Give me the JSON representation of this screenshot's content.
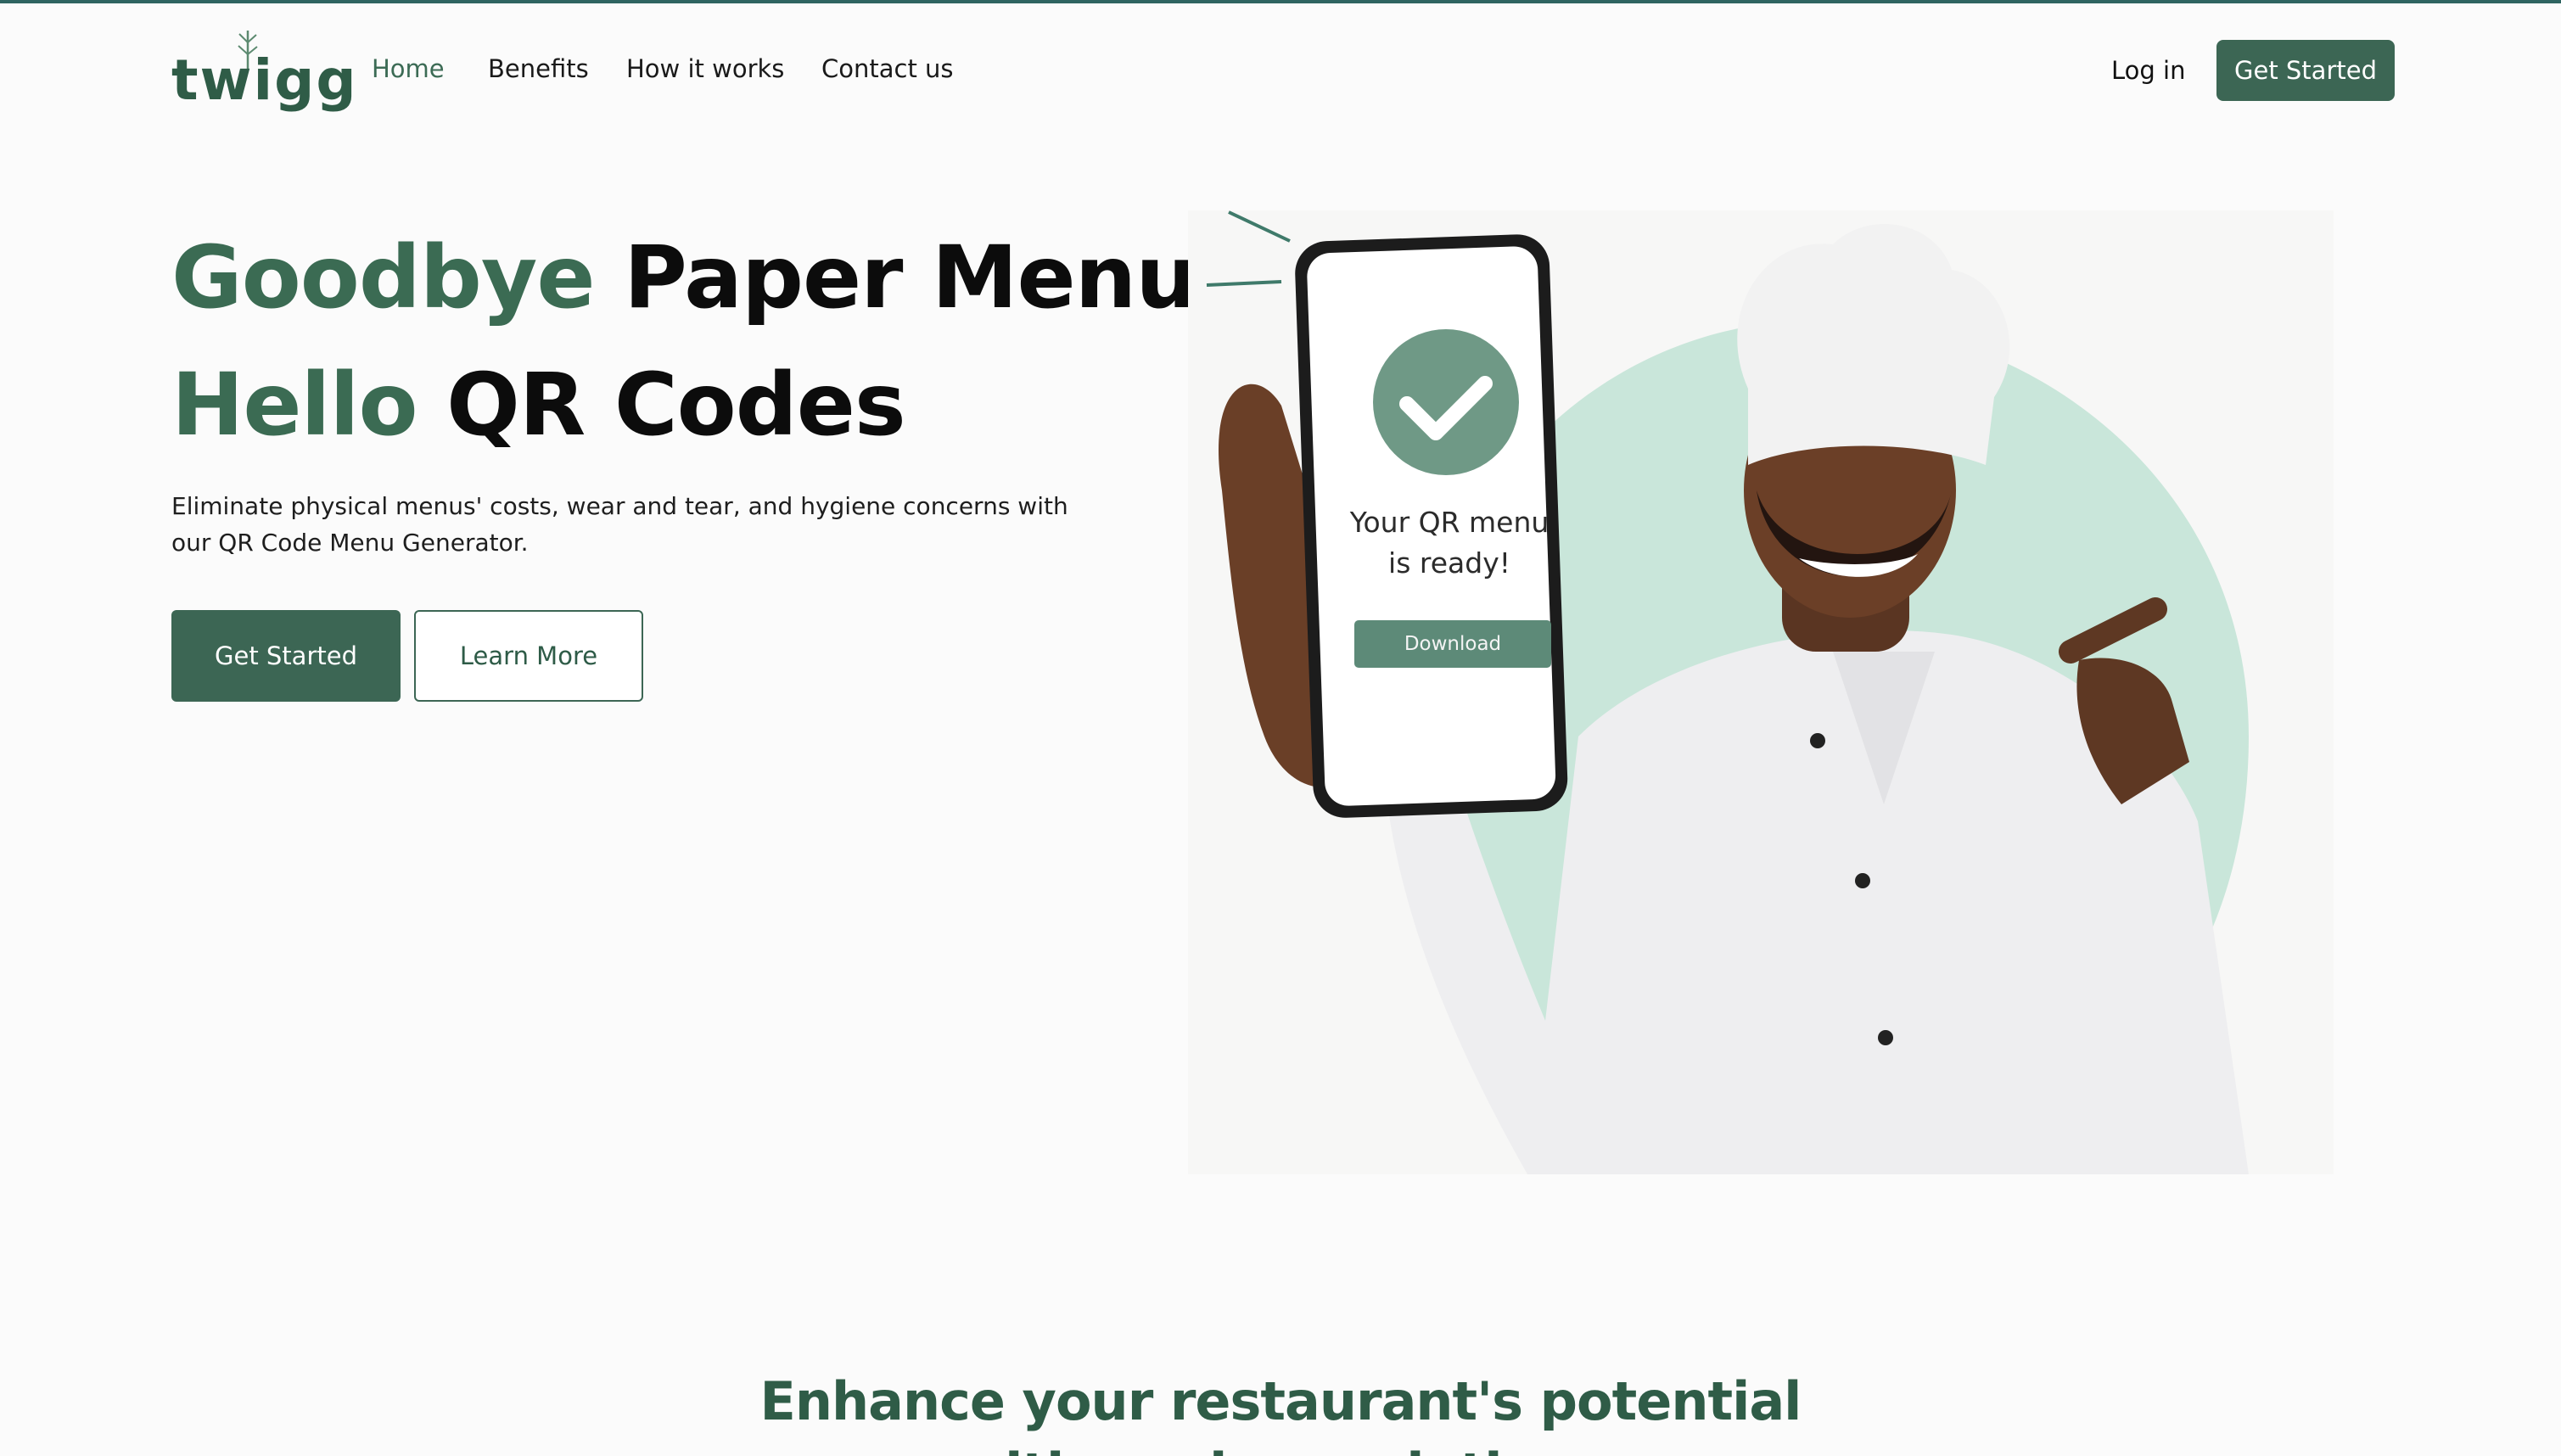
{
  "brand": {
    "logo_text": "twigg",
    "accent": "#3c6654",
    "accent_text": "#3b6b53",
    "mint": "#c9e6da"
  },
  "nav": {
    "links": [
      {
        "label": "Home",
        "active": true
      },
      {
        "label": "Benefits",
        "active": false
      },
      {
        "label": "How it works",
        "active": false
      },
      {
        "label": "Contact us",
        "active": false
      }
    ],
    "login": "Log in",
    "cta": "Get Started"
  },
  "hero": {
    "line1_green": "Goodbye",
    "line1_dark": "Paper Menus,",
    "line2_green": "Hello",
    "line2_dark": "QR Codes",
    "description": "Eliminate physical menus' costs, wear and tear, and hygiene concerns with our QR Code Menu Generator.",
    "primary_button": "Get Started",
    "secondary_button": "Learn More"
  },
  "phone": {
    "title_line1": "Your QR menu",
    "title_line2": "is ready!",
    "button": "Download"
  },
  "section": {
    "heading_line1": "Enhance your restaurant's potential",
    "heading_line2": "with modern solutions"
  }
}
